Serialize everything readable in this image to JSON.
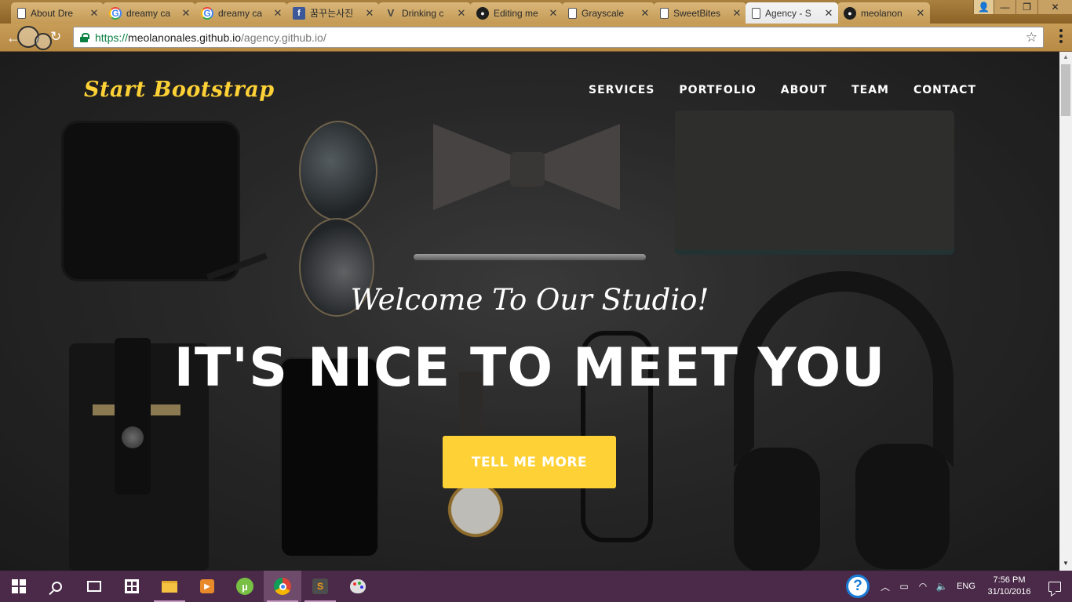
{
  "browser": {
    "tabs": [
      {
        "title": "About Dre",
        "favicon": "document-icon",
        "active": false
      },
      {
        "title": "dreamy ca",
        "favicon": "google-icon",
        "active": false
      },
      {
        "title": "dreamy ca",
        "favicon": "google-icon",
        "active": false
      },
      {
        "title": "꿈꾸는사진",
        "favicon": "facebook-icon",
        "active": false
      },
      {
        "title": "Drinking c",
        "favicon": "vimeo-icon",
        "active": false
      },
      {
        "title": "Editing me",
        "favicon": "github-icon",
        "active": false
      },
      {
        "title": "Grayscale",
        "favicon": "document-icon",
        "active": false
      },
      {
        "title": "SweetBites",
        "favicon": "document-icon",
        "active": false
      },
      {
        "title": "Agency - S",
        "favicon": "document-icon",
        "active": true
      },
      {
        "title": "meolanon",
        "favicon": "github-icon",
        "active": false
      }
    ],
    "tab_close_glyph": "✕",
    "url": {
      "scheme": "https://",
      "host": "meolanonales.github.io",
      "path": "/agency.github.io/"
    },
    "back_glyph": "←",
    "reload_glyph": "↻",
    "star_glyph": "☆",
    "window_controls": {
      "minimize": "—",
      "maximize": "❐",
      "close": "✕",
      "user": "👤"
    }
  },
  "site": {
    "brand": "Start Bootstrap",
    "nav": [
      "Services",
      "Portfolio",
      "About",
      "Team",
      "Contact"
    ],
    "hero": {
      "lead": "Welcome To Our Studio!",
      "heading": "It's Nice To Meet You",
      "cta": "Tell Me More"
    },
    "colors": {
      "accent": "#fed136",
      "text": "#ffffff"
    }
  },
  "taskbar": {
    "apps": [
      {
        "name": "start-icon",
        "running": false,
        "active": false
      },
      {
        "name": "search-icon",
        "running": false,
        "active": false
      },
      {
        "name": "task-view-icon",
        "running": false,
        "active": false
      },
      {
        "name": "store-icon",
        "running": false,
        "active": false
      },
      {
        "name": "file-explorer-icon",
        "running": true,
        "active": false
      },
      {
        "name": "media-player-icon",
        "running": false,
        "active": false
      },
      {
        "name": "utorrent-icon",
        "running": false,
        "active": false
      },
      {
        "name": "chrome-icon",
        "running": true,
        "active": true
      },
      {
        "name": "sublime-text-icon",
        "running": true,
        "active": false
      },
      {
        "name": "paint-icon",
        "running": false,
        "active": false
      }
    ],
    "tray": {
      "help_glyph": "?",
      "language": "ENG",
      "time": "7:56 PM",
      "date": "31/10/2016"
    }
  }
}
